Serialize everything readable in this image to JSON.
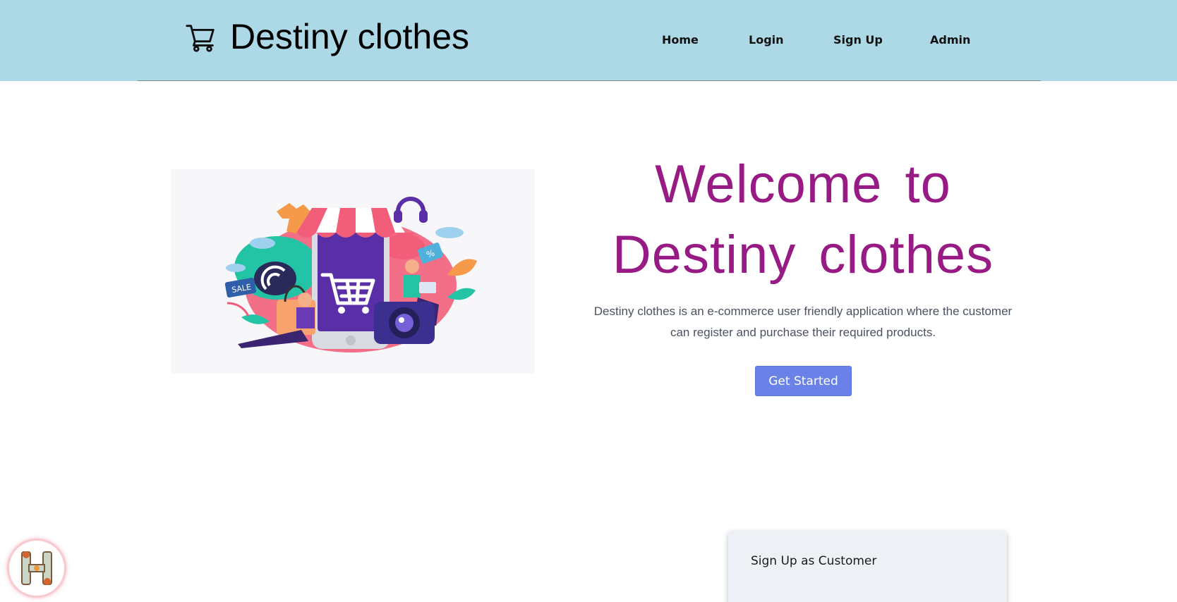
{
  "header": {
    "brand_title": "Destiny clothes",
    "brand_icon": "cart-icon",
    "nav": [
      {
        "label": "Home"
      },
      {
        "label": "Login"
      },
      {
        "label": "Sign Up"
      },
      {
        "label": "Admin"
      }
    ],
    "background": "#add8e6"
  },
  "hero": {
    "illustration": {
      "icon": "online-shopping-illustration",
      "sale_tag": "SALE",
      "percent_tag": "%"
    },
    "title_line1": "Welcome to",
    "title_line2": "Destiny clothes",
    "title_color": "#981b85",
    "description": "Destiny clothes is an e-commerce user friendly application where the customer can register and purchase their required products.",
    "cta_label": "Get Started",
    "cta_color": "#6a82e8"
  },
  "signup_card": {
    "title": "Sign Up as Customer"
  },
  "floating_badge": {
    "icon": "h-logo-icon",
    "letter": "H"
  }
}
